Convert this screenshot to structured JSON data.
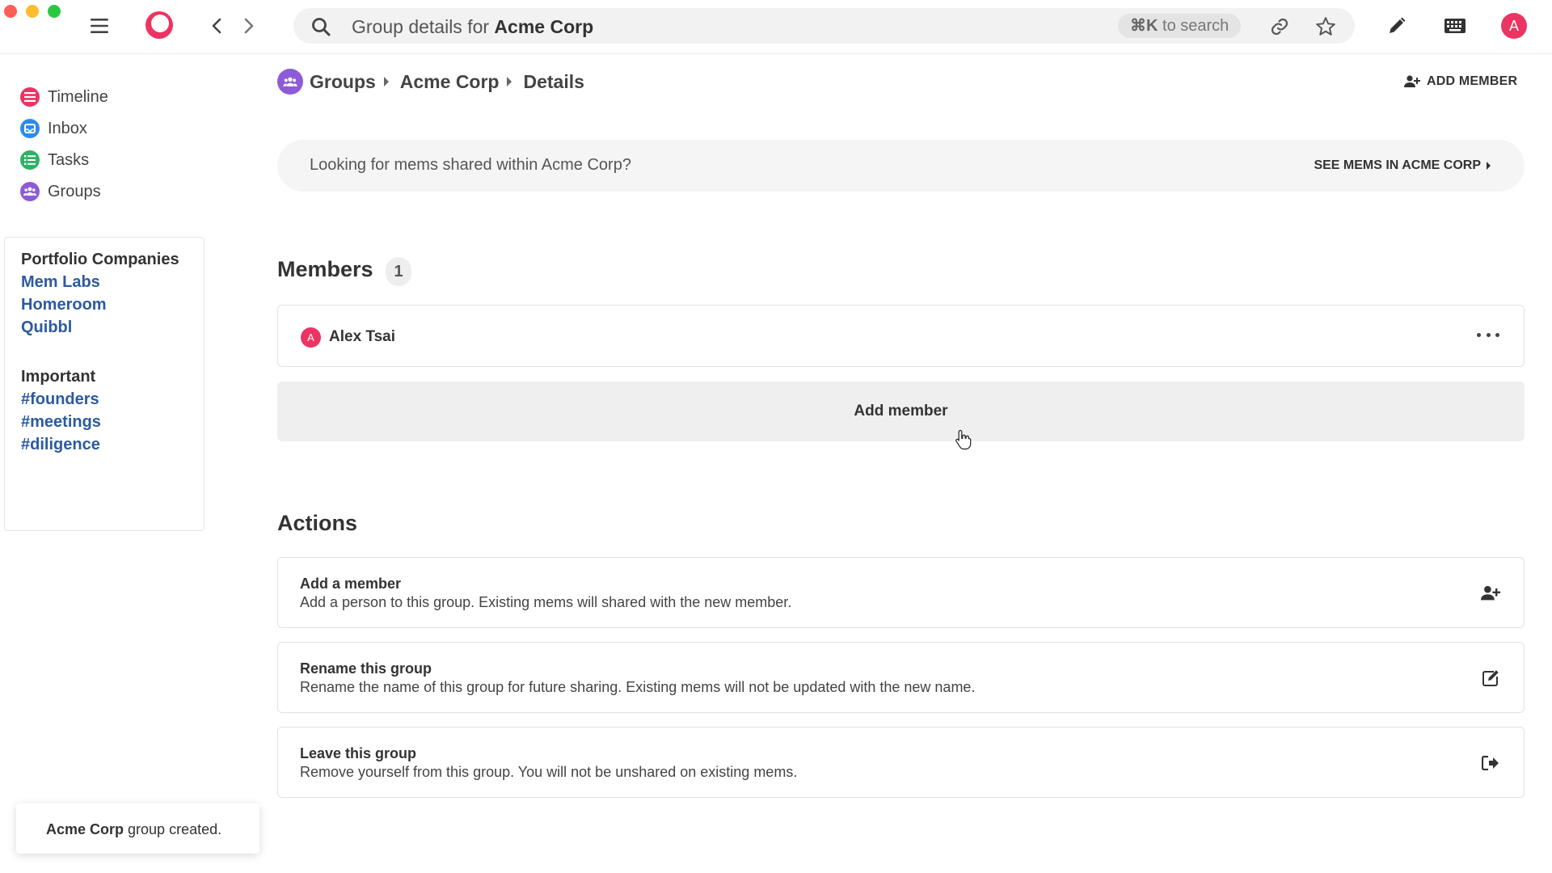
{
  "window": {
    "traffic_lights": {
      "close": "#ff5f57",
      "minimize": "#febc2e",
      "maximize": "#28c840"
    }
  },
  "topbar": {
    "icons": [
      "menu-icon",
      "mem-logo-icon",
      "back-icon",
      "forward-icon",
      "link-icon",
      "star-icon",
      "pencil-icon",
      "keyboard-icon"
    ],
    "search": {
      "prefix": "Group details for ",
      "emphasis": "Acme Corp",
      "shortcut_key": "⌘K",
      "shortcut_text": " to search"
    },
    "avatar_letter": "A",
    "accent": "#ec3462"
  },
  "sidebar": {
    "nav": [
      {
        "label": "Timeline",
        "icon": "timeline-icon",
        "color": "#ec3462"
      },
      {
        "label": "Inbox",
        "icon": "inbox-icon",
        "color": "#2e8ce6"
      },
      {
        "label": "Tasks",
        "icon": "tasks-icon",
        "color": "#2db463"
      },
      {
        "label": "Groups",
        "icon": "groups-icon",
        "color": "#8e5bd8"
      }
    ],
    "shortcuts": {
      "section1_title": "Portfolio Companies",
      "section1_links": [
        "Mem Labs",
        "Homeroom",
        "Quibbl"
      ],
      "section2_title": "Important",
      "section2_links": [
        "#founders",
        "#meetings",
        "#diligence"
      ]
    }
  },
  "breadcrumb": [
    "Groups",
    "Acme Corp",
    "Details"
  ],
  "header_action": "ADD MEMBER",
  "banner": {
    "text": "Looking for mems shared within Acme Corp?",
    "link": "SEE MEMS IN ACME CORP"
  },
  "members": {
    "title": "Members",
    "count": "1",
    "list": [
      {
        "initial": "A",
        "name": "Alex Tsai"
      }
    ],
    "add_button": "Add member"
  },
  "actions": {
    "title": "Actions",
    "items": [
      {
        "title": "Add a member",
        "desc": "Add a person to this group. Existing mems will shared with the new member.",
        "icon": "add-user-icon"
      },
      {
        "title": "Rename this group",
        "desc": "Rename the name of this group for future sharing. Existing mems will not be updated with the new name.",
        "icon": "edit-icon"
      },
      {
        "title": "Leave this group",
        "desc": "Remove yourself from this group. You will not be unshared on existing mems.",
        "icon": "leave-icon"
      }
    ]
  },
  "toast": {
    "bold": "Acme Corp",
    "rest": " group created."
  }
}
